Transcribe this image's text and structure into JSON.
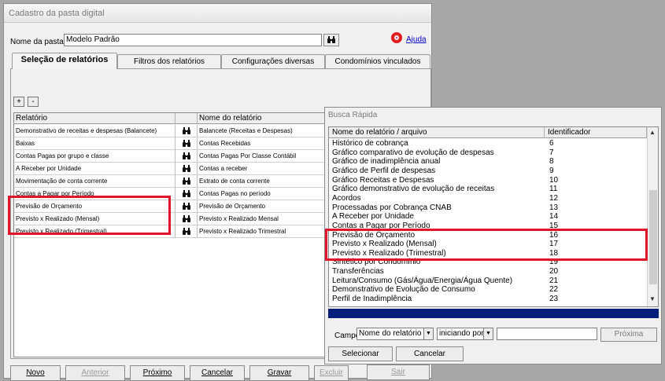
{
  "window": {
    "title": "Cadastro da pasta digital",
    "folder_label": "Nome da pasta:",
    "folder_value": "Modelo Padrão",
    "help_link": "Ajuda"
  },
  "tabs": [
    {
      "label": "Seleção de relatórios",
      "active": true
    },
    {
      "label": "Filtros dos relatórios",
      "active": false
    },
    {
      "label": "Configurações diversas",
      "active": false
    },
    {
      "label": "Condomínios vinculados",
      "active": false
    }
  ],
  "grid_buttons": {
    "add": "+",
    "remove": "-"
  },
  "grid": {
    "headers": [
      "Relatório",
      "Nome do relatório"
    ],
    "rows": [
      {
        "report": "Demonstrativo de receitas e despesas (Balancete)",
        "name": "Balancete (Receitas e Despesas)"
      },
      {
        "report": "Baixas",
        "name": "Contas Recebidas"
      },
      {
        "report": "Contas Pagas por grupo e classe",
        "name": "Contas Pagas Por Classe Contábil"
      },
      {
        "report": "A Receber por Unidade",
        "name": "Contas a receber"
      },
      {
        "report": "Movimentação de conta corrente",
        "name": "Extrato de conta corrente"
      },
      {
        "report": "Contas a Pagar por Período",
        "name": "Contas Pagas no período"
      },
      {
        "report": "Previsão de Orçamento",
        "name": "Previsão de Orçamento"
      },
      {
        "report": "Previsto x Realizado (Mensal)",
        "name": "Previsto x Realizado Mensal"
      },
      {
        "report": "Previsto x Realizado (Trimestral)",
        "name": "Previsto x Realizado Trimestral"
      }
    ]
  },
  "actions": {
    "novo": "Novo",
    "anterior": "Anterior",
    "proximo": "Próximo",
    "cancelar": "Cancelar",
    "gravar": "Gravar",
    "excluir": "Excluir",
    "sair": "Sair"
  },
  "busca": {
    "title": "Busca Rápida",
    "headers": [
      "Nome do relatório / arquivo",
      "Identificador"
    ],
    "rows": [
      {
        "name": "Histórico de cobrança",
        "id": "6"
      },
      {
        "name": "Gráfico comparativo de evolução de despesas",
        "id": "7"
      },
      {
        "name": "Gráfico de inadimplência anual",
        "id": "8"
      },
      {
        "name": "Gráfico de Perfil de despesas",
        "id": "9"
      },
      {
        "name": "Gráfico Receitas e Despesas",
        "id": "10"
      },
      {
        "name": "Gráfico demonstrativo de evolução de receitas",
        "id": "11"
      },
      {
        "name": "Acordos",
        "id": "12"
      },
      {
        "name": "Processadas por Cobrança CNAB",
        "id": "13"
      },
      {
        "name": "A Receber por Unidade",
        "id": "14"
      },
      {
        "name": "Contas a Pagar por Período",
        "id": "15"
      },
      {
        "name": "Previsão de Orçamento",
        "id": "16"
      },
      {
        "name": "Previsto x Realizado (Mensal)",
        "id": "17"
      },
      {
        "name": "Previsto x Realizado (Trimestral)",
        "id": "18"
      },
      {
        "name": "Sintético por Condomínio",
        "id": "19"
      },
      {
        "name": "Transferências",
        "id": "20"
      },
      {
        "name": "Leitura/Consumo (Gás/Água/Energia/Água Quente)",
        "id": "21"
      },
      {
        "name": "Demonstrativo de Evolução de Consumo",
        "id": "22"
      },
      {
        "name": "Perfil de Inadimplência",
        "id": "23"
      }
    ],
    "campo_label": "Campo:",
    "campo_value": "Nome do relatório / a",
    "mode_value": "iniciando por",
    "proxima": "Próxima",
    "select": "Selecionar",
    "cancel": "Cancelar"
  },
  "colors": {
    "highlight": "#e0152b",
    "navy_bar": "#001f7a",
    "help_icon": "#e11d1d",
    "link": "#0000cc"
  }
}
